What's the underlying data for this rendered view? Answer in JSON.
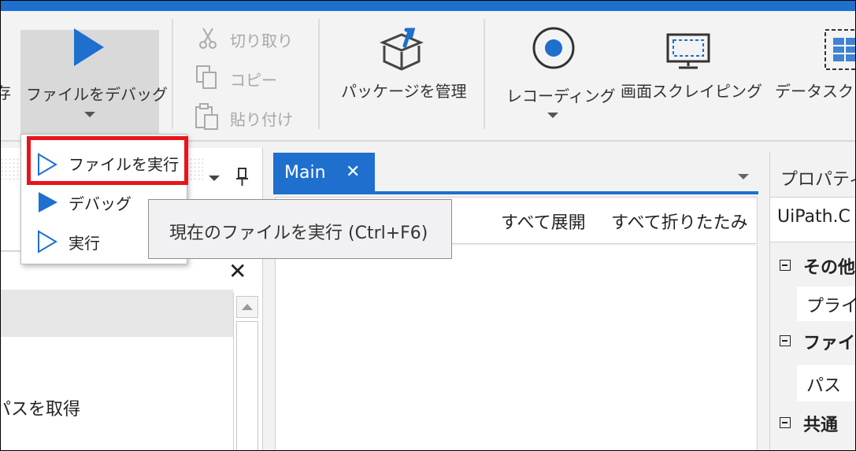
{
  "ribbon": {
    "left_cut_label": "存",
    "debug_file": "ファイルをデバッグ",
    "cut": "切り取り",
    "copy": "コピー",
    "paste": "貼り付け",
    "manage_packages": "パッケージを管理",
    "recording": "レコーディング",
    "screen_scraping": "画面スクレイピング",
    "data_scraping": "データスクレ"
  },
  "dropdown": {
    "items": [
      {
        "label": "ファイルを実行",
        "icon": "play-outline-icon"
      },
      {
        "label": "デバッグ",
        "icon": "play-filled-icon"
      },
      {
        "label": "実行",
        "icon": "play-outline-icon"
      }
    ]
  },
  "tooltip": {
    "text": "現在のファイルを実行 (Ctrl+F6)"
  },
  "left_panel": {
    "close_symbol": "✕",
    "item_text": "パスを取得"
  },
  "editor": {
    "tab_label": "Main",
    "tab_close": "✕",
    "expand_all": "すべて展開",
    "collapse_all": "すべて折りたたみ"
  },
  "properties": {
    "title": "プロパティ",
    "activity": "UiPath.C",
    "categories": [
      {
        "name": "その他",
        "rows": [
          "プライ"
        ]
      },
      {
        "name": "ファイル",
        "rows": [
          "パス"
        ]
      },
      {
        "name": "共通",
        "rows": []
      }
    ]
  },
  "colors": {
    "accent": "#1e6fce",
    "highlight": "#e8141b"
  }
}
